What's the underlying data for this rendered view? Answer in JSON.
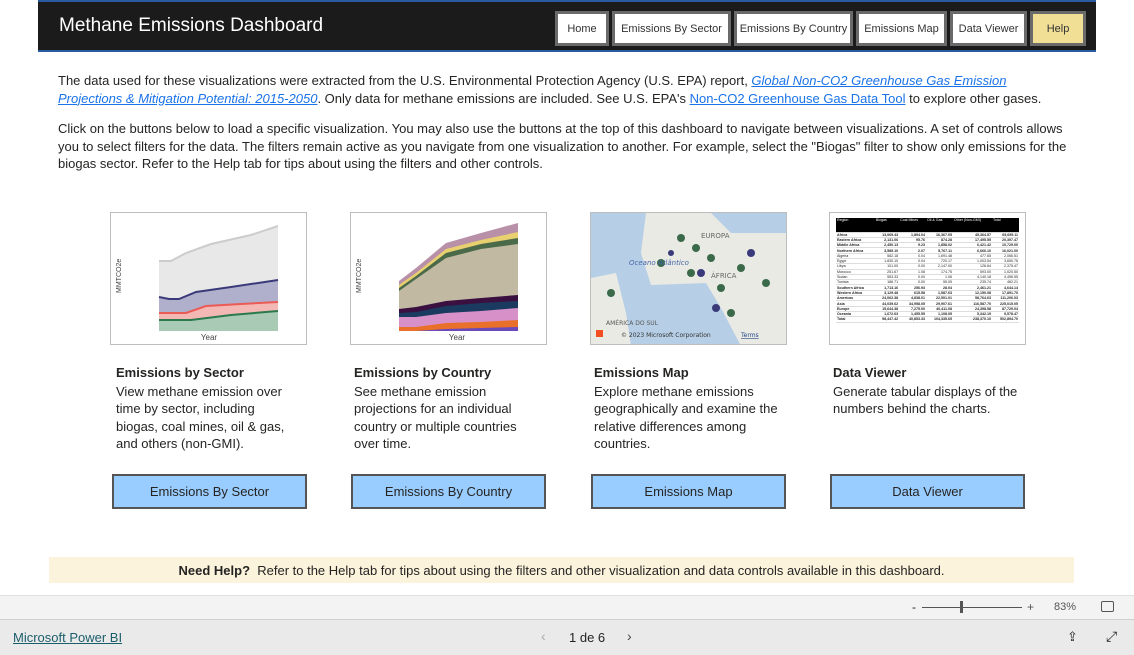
{
  "header": {
    "title": "Methane Emissions Dashboard",
    "nav": [
      "Home",
      "Emissions By Sector",
      "Emissions By Country",
      "Emissions Map",
      "Data Viewer",
      "Help"
    ]
  },
  "intro": {
    "p1_a": "The data used for these visualizations were extracted from the U.S. Environmental Protection Agency (U.S. EPA) report, ",
    "p1_link1": "Global Non-CO2 Greenhouse Gas Emission Projections & Mitigation Potential: 2015-2050",
    "p1_b": ". Only data for methane emissions are included. See U.S. EPA's ",
    "p1_link2": "Non-CO2 Greenhouse Gas Data Tool",
    "p1_c": " to explore other gases.",
    "p2": "Click on the buttons below to load a specific visualization. You may also use the buttons at the top of this dashboard to navigate between visualizations.  A set of controls allows you to select filters for the data.  The filters remain active as you navigate from one visualization to another. For example, select the \"Biogas\" filter to show only emissions for the biogas sector.  Refer to the Help tab for tips about using the filters and other controls."
  },
  "cards": [
    {
      "title": "Emissions by Sector",
      "desc": "View methane emission over time by sector, including biogas, coal mines, oil & gas, and others (non-GMI).",
      "button": "Emissions By Sector",
      "thumb": {
        "ylabel": "MMTCO2e",
        "xlabel": "Year"
      }
    },
    {
      "title": "Emissions by Country",
      "desc": "See methane emission projections for an individual country or multiple countries over time.",
      "button": "Emissions By Country",
      "thumb": {
        "ylabel": "MMTCO2e",
        "xlabel": "Year"
      }
    },
    {
      "title": "Emissions Map",
      "desc": "Explore methane emissions geographically and examine the relative differences among countries.",
      "button": "Emissions Map",
      "thumb": {
        "ocean": "Oceano Atlântico",
        "europe": "EUROPA",
        "africa": "ÁFRICA",
        "america": "AMÉRICA DO SUL",
        "copyright": "© 2023 Microsoft Corporation",
        "terms": "Terms"
      }
    },
    {
      "title": "Data Viewer",
      "desc": "Generate tabular displays of the numbers behind the charts.",
      "button": "Data Viewer",
      "thumb": {
        "headers": [
          "Region",
          "Biogas",
          "Coal Mines",
          "Oil & Gas",
          "Other (Non-GMI)",
          "Total"
        ],
        "rows": [
          [
            "Africa",
            "13,069.43",
            "1,894.04",
            "16,367.05",
            "45,364.57",
            "69,695.11"
          ],
          [
            "Eastern Africa",
            "2,131.06",
            "95.76",
            "874.28",
            "17,495.55",
            "20,397.47"
          ],
          [
            "Middle Africa",
            "2,450.13",
            "9.23",
            "1,858.02",
            "6,421.42",
            "10,729.00"
          ],
          [
            "Northern Africa",
            "3,585.10",
            "2.07",
            "5,767.11",
            "6,666.10",
            "16,021.00"
          ],
          [
            "Algeria",
            "582.18",
            "0.04",
            "1,691.48",
            "477.65",
            "2,066.51"
          ],
          [
            "Egypt",
            "1,830.10",
            "0.04",
            "720.17",
            "1,003.54",
            "3,650.76"
          ],
          [
            "Libya",
            "101.00",
            "0.00",
            "2,147.00",
            "126.64",
            "2,375.47"
          ],
          [
            "Morocco",
            "251.67",
            "1.08",
            "174.75",
            "593.00",
            "1,020.50"
          ],
          [
            "Sudan",
            "553.33",
            "0.00",
            "1.06",
            "4,140.18",
            "4,496.55"
          ],
          [
            "Tunisia",
            "186.71",
            "0.00",
            "55.05",
            "235.74",
            "462.21"
          ],
          [
            "Southern Africa",
            "1,713.16",
            "256.93",
            "28.04",
            "2,461.21",
            "4,644.14"
          ],
          [
            "Western Africa",
            "3,129.48",
            "615.58",
            "1,587.63",
            "12,150.08",
            "17,891.70"
          ],
          [
            "Americas",
            "24,062.38",
            "4,838.01",
            "22,501.01",
            "58,764.63",
            "111,206.03"
          ],
          [
            "Asia",
            "44,039.62",
            "34,958.05",
            "29,907.61",
            "116,587.70",
            "225,015.05"
          ],
          [
            "Europe",
            "15,644.38",
            "7,275.00",
            "40,411.08",
            "24,398.58",
            "87,729.04"
          ],
          [
            "Oceania",
            "1,672.63",
            "1,455.55",
            "1,108.05",
            "5,342.19",
            "9,578.47"
          ],
          [
            "Total",
            "98,447.42",
            "40,853.33",
            "104,335.65",
            "238,370.10",
            "502,894.70"
          ]
        ]
      }
    }
  ],
  "help_bar": {
    "bold": "Need Help?",
    "text": "  Refer to the Help tab for tips about using the filters and other visualization and data controls available in this dashboard."
  },
  "zoom": {
    "minus": "-",
    "plus": "+",
    "level": "83%",
    "value_percent": 83
  },
  "footer": {
    "brand": "Microsoft Power BI",
    "page": "1 de 6"
  },
  "colors": {
    "header_bg": "#1b1b1b",
    "help_btn": "#f0df95",
    "card_btn": "#99ccff",
    "help_bar_bg": "#fbf3dc"
  }
}
